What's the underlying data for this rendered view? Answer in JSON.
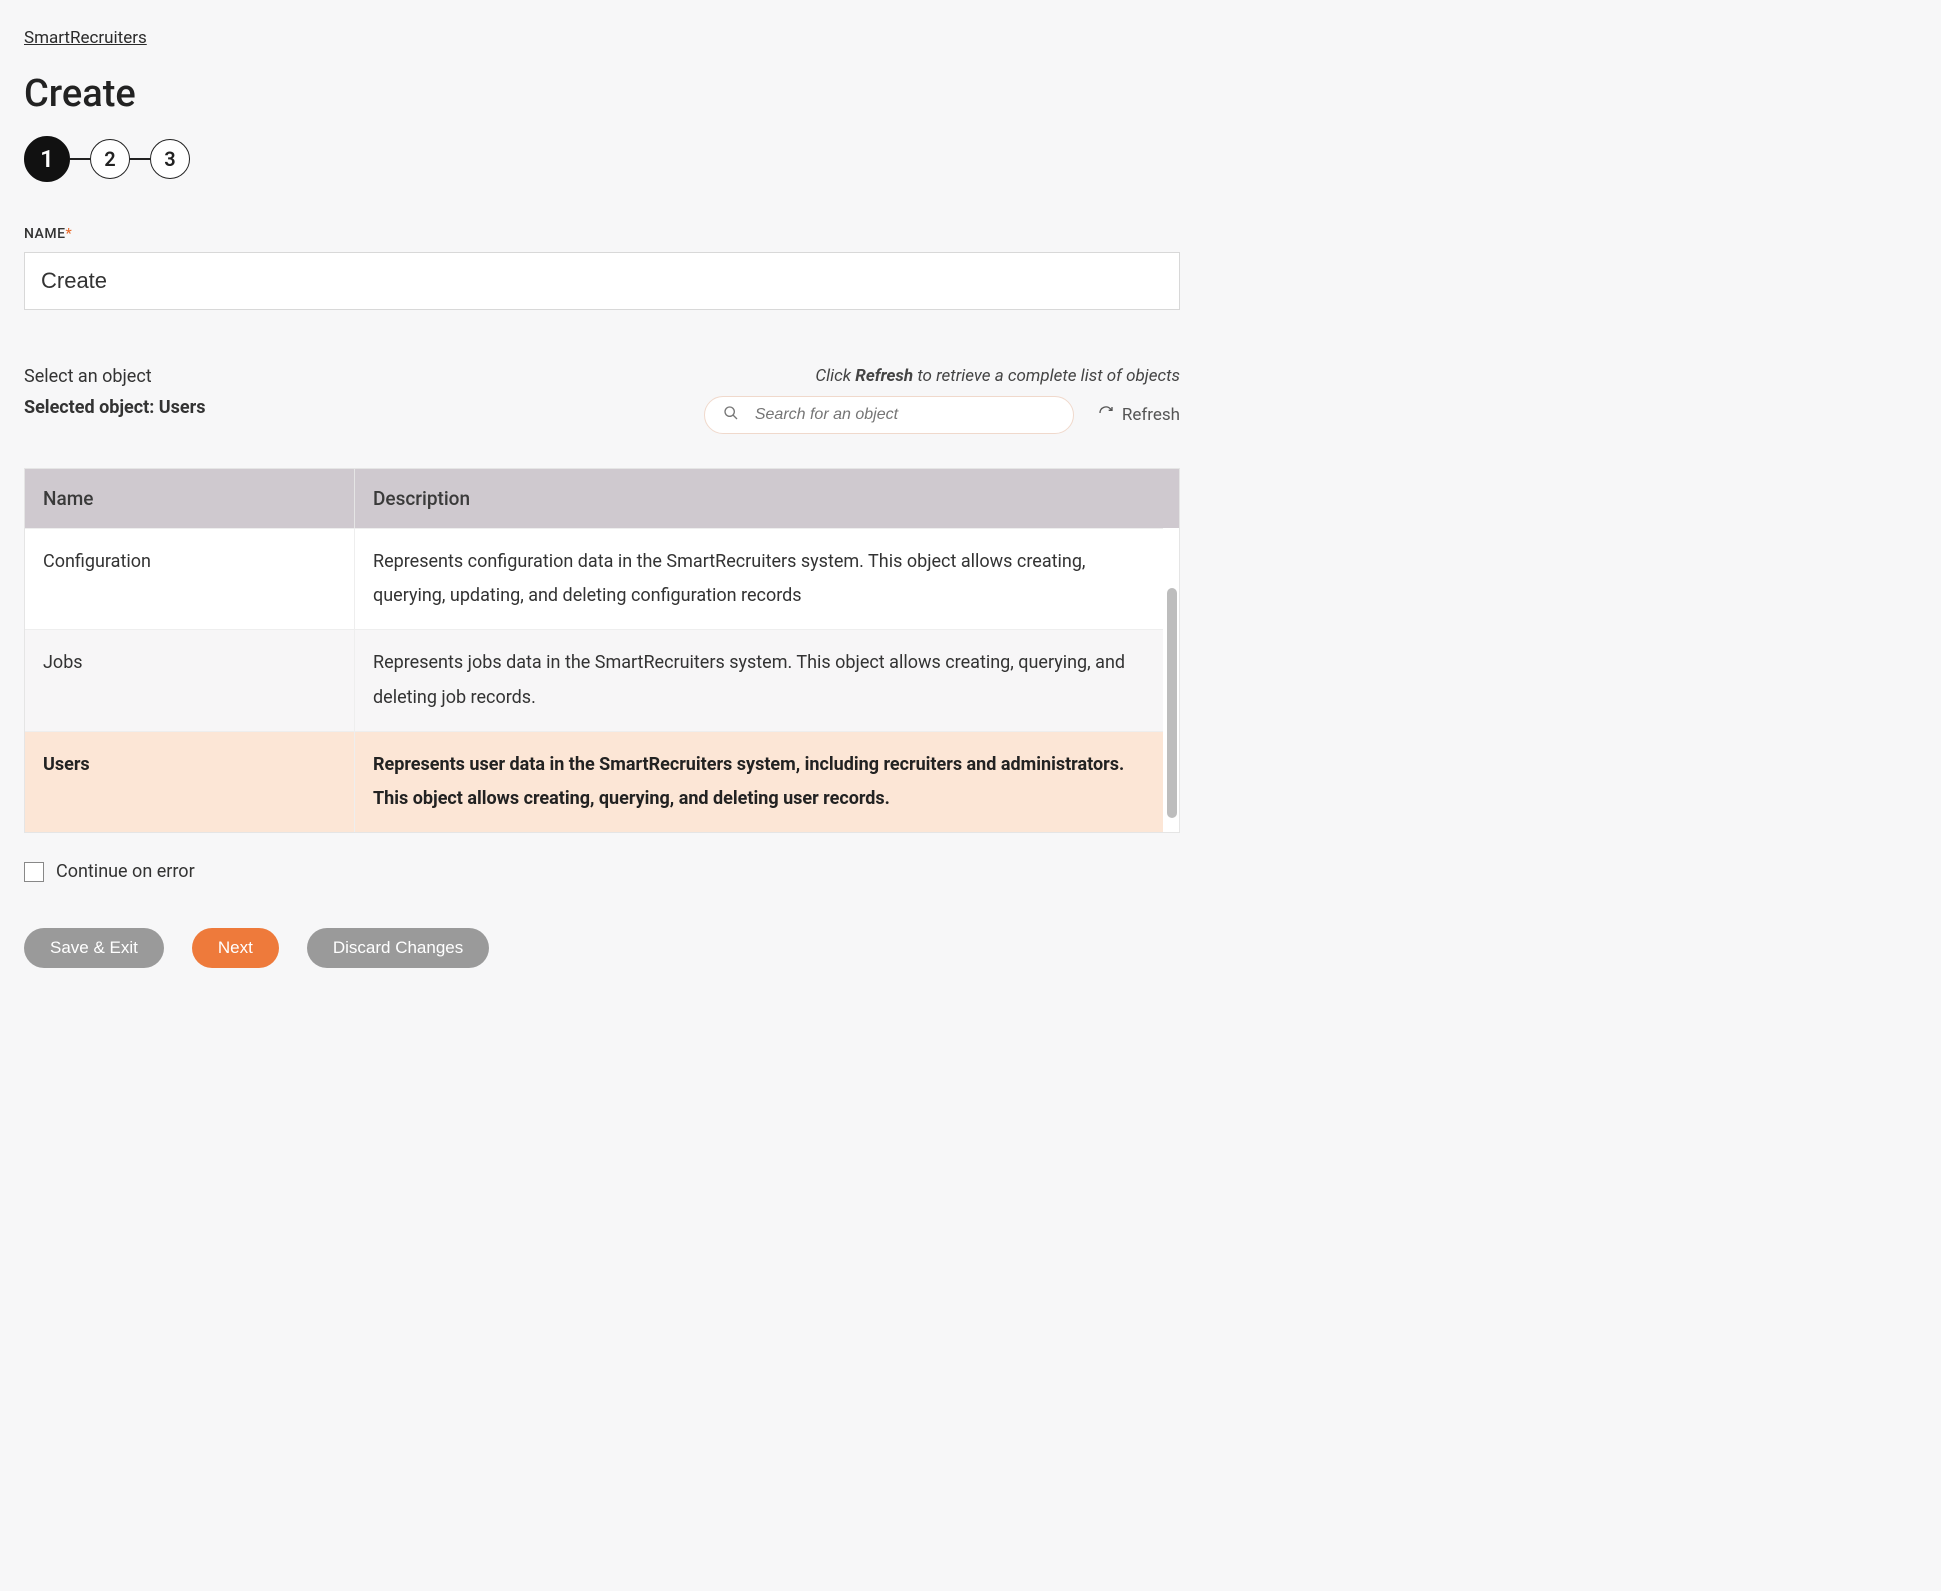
{
  "breadcrumb": {
    "label": "SmartRecruiters"
  },
  "page_title": "Create",
  "stepper": {
    "steps": [
      "1",
      "2",
      "3"
    ],
    "active_index": 0
  },
  "name_field": {
    "label": "NAME",
    "required_mark": "*",
    "value": "Create"
  },
  "object_select": {
    "prompt": "Select an object",
    "selected_prefix": "Selected object: ",
    "selected_value": "Users",
    "hint_prefix": "Click ",
    "hint_bold": "Refresh",
    "hint_suffix": " to retrieve a complete list of objects",
    "search_placeholder": "Search for an object",
    "refresh_label": "Refresh"
  },
  "table": {
    "headers": {
      "name": "Name",
      "description": "Description"
    },
    "rows": [
      {
        "name": "Configuration",
        "description": "Represents configuration data in the SmartRecruiters system. This object allows creating, querying, updating, and deleting configuration records",
        "selected": false,
        "alt": false
      },
      {
        "name": "Jobs",
        "description": "Represents jobs data in the SmartRecruiters system. This object allows creating, querying, and deleting job records.",
        "selected": false,
        "alt": true
      },
      {
        "name": "Users",
        "description": "Represents user data in the SmartRecruiters system, including recruiters and administrators. This object allows creating, querying, and deleting user records.",
        "selected": true,
        "alt": false
      }
    ]
  },
  "continue_on_error": {
    "label": "Continue on error",
    "checked": false
  },
  "buttons": {
    "save_exit": "Save & Exit",
    "next": "Next",
    "discard": "Discard Changes"
  }
}
